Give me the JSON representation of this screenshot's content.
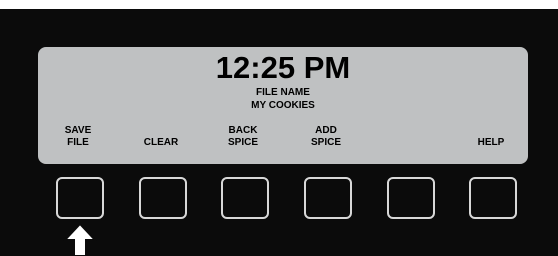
{
  "display": {
    "time": "12:25 PM",
    "line1": "FILE NAME",
    "line2": "MY COOKIES"
  },
  "softkeys": [
    {
      "line1": "SAVE",
      "line2": "FILE"
    },
    {
      "line1": "",
      "line2": "CLEAR"
    },
    {
      "line1": "BACK",
      "line2": "SPICE"
    },
    {
      "line1": "ADD",
      "line2": "SPICE"
    },
    {
      "line1": "",
      "line2": ""
    },
    {
      "line1": "",
      "line2": "HELP"
    }
  ],
  "indicator": {
    "icon": "up-arrow-icon",
    "target_button": 1
  },
  "colors": {
    "device": "#0b0b0b",
    "screen": "#bfc1c2",
    "button_border": "#d8d8d8",
    "arrow": "#ffffff"
  }
}
